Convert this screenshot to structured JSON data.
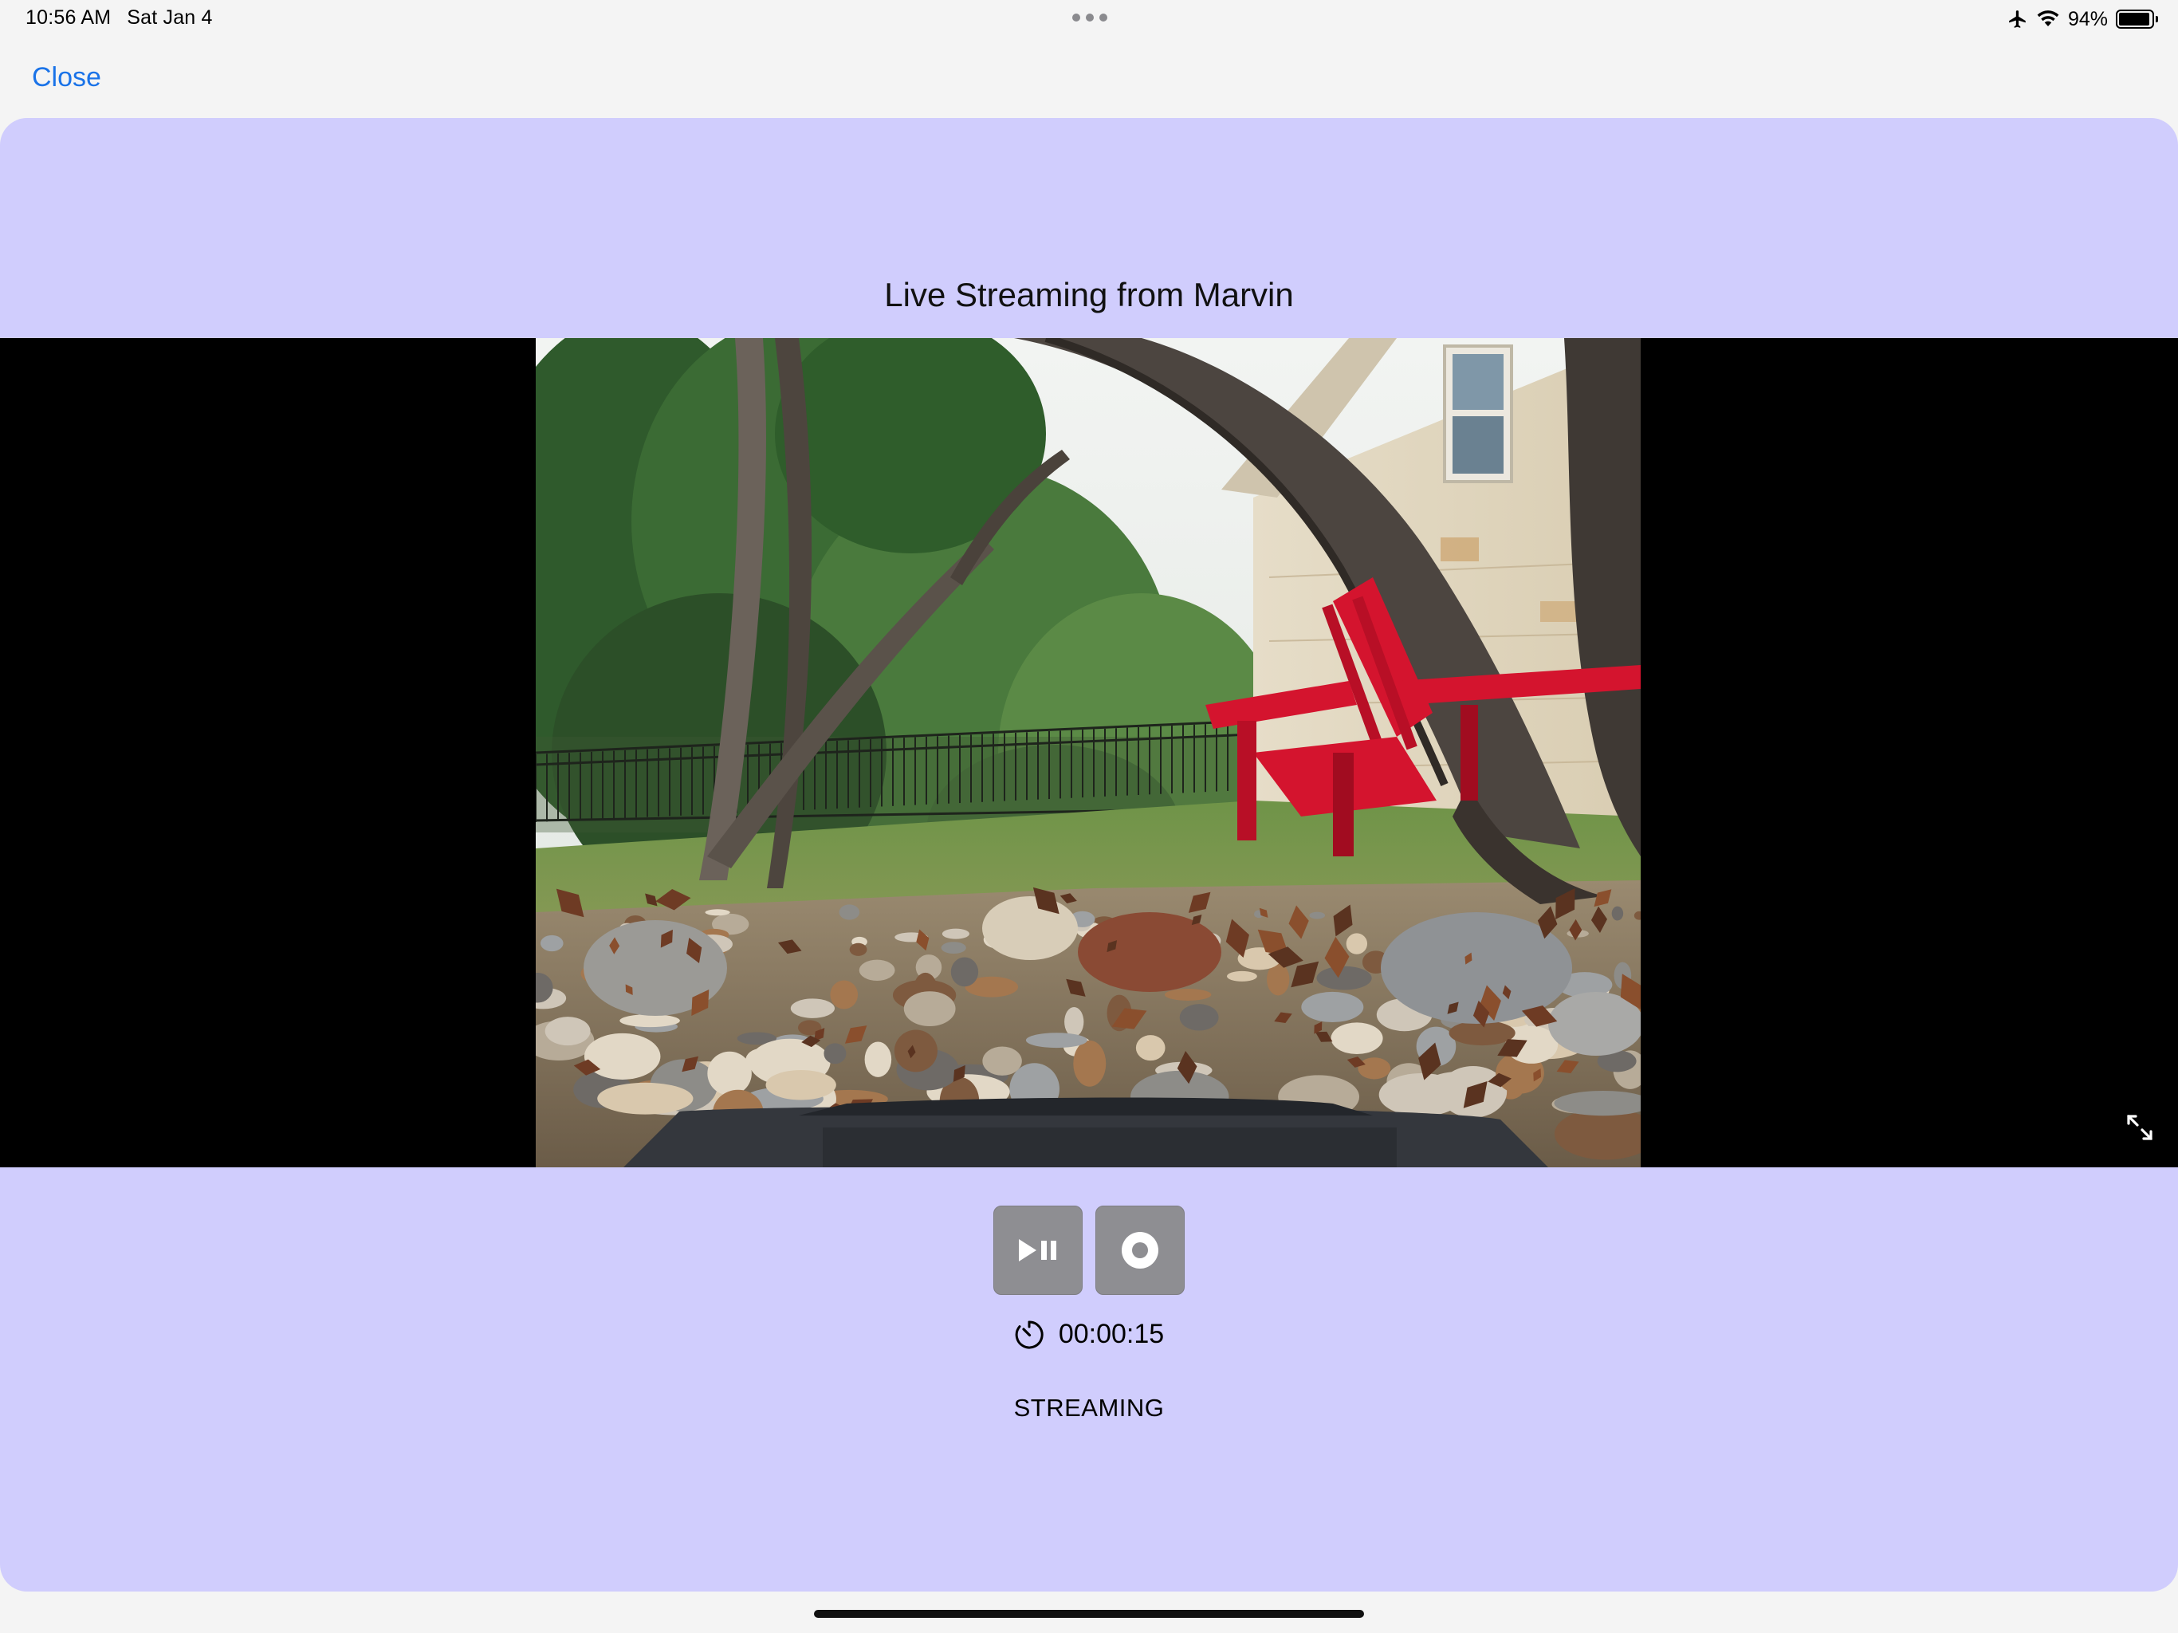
{
  "status_bar": {
    "time": "10:56 AM",
    "date": "Sat Jan 4",
    "battery_percent": "94%",
    "battery_level": 0.94,
    "icons": [
      "airplane-icon",
      "wifi-icon",
      "battery-icon"
    ]
  },
  "nav": {
    "close_label": "Close"
  },
  "stream": {
    "title": "Live Streaming from Marvin",
    "elapsed": "00:00:15",
    "status": "STREAMING"
  },
  "controls": {
    "icons": [
      "play-pause-icon",
      "record-icon",
      "timer-icon",
      "fullscreen-icon"
    ]
  },
  "colors": {
    "sheet_background": "#d0cdfd",
    "link": "#1a73e8",
    "button": "#8e8e92",
    "chair": "#d4142e"
  }
}
